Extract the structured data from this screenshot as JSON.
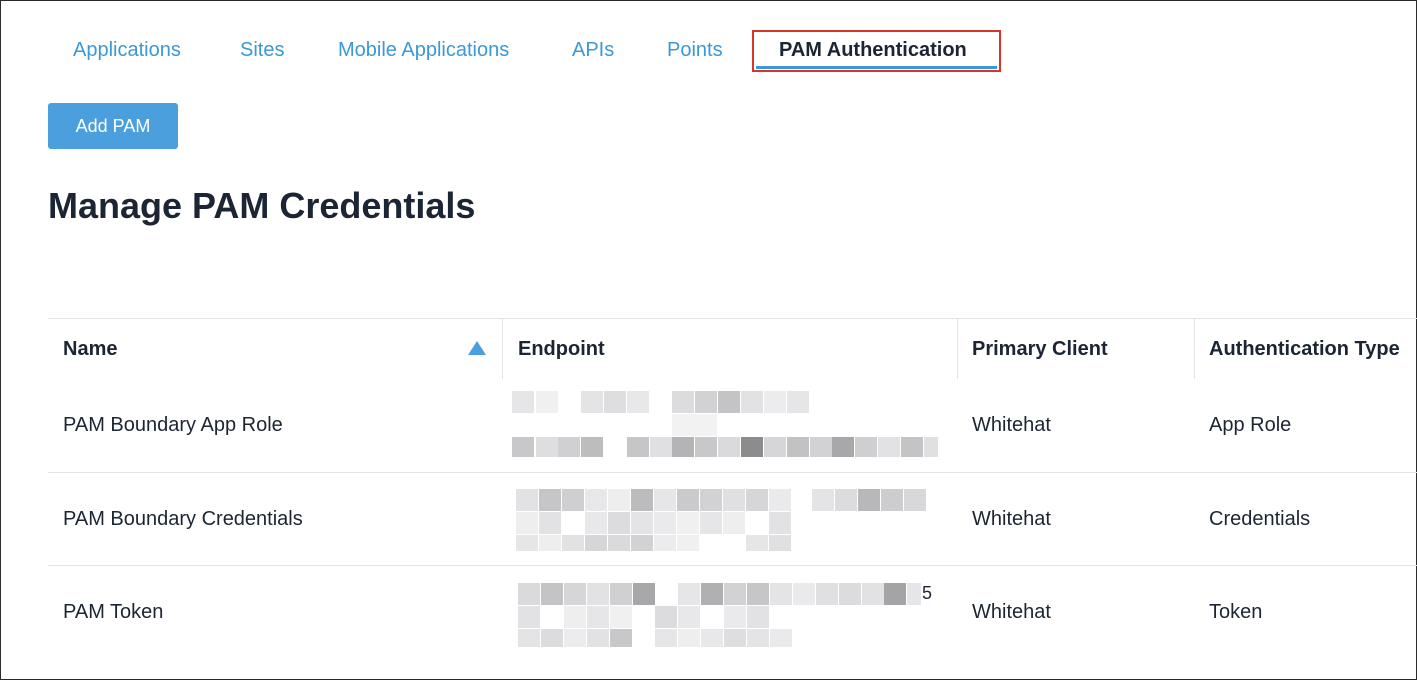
{
  "tabs": [
    {
      "label": "Applications"
    },
    {
      "label": "Sites"
    },
    {
      "label": "Mobile Applications"
    },
    {
      "label": "APIs"
    },
    {
      "label": "Points"
    },
    {
      "label": "PAM Authentication"
    }
  ],
  "active_tab": "PAM Authentication",
  "add_button": {
    "label": "Add PAM"
  },
  "page_title": "Manage PAM Credentials",
  "table": {
    "columns": [
      "Name",
      "Endpoint",
      "Primary Client",
      "Authentication Type"
    ],
    "sort": {
      "column": "Name",
      "direction": "ascending"
    },
    "rows": [
      {
        "name": "PAM Boundary App Role",
        "endpoint": "",
        "primary_client": "Whitehat",
        "auth_type": "App Role"
      },
      {
        "name": "PAM Boundary Credentials",
        "endpoint": "",
        "primary_client": "Whitehat",
        "auth_type": "Credentials"
      },
      {
        "name": "PAM Token",
        "endpoint": "5",
        "primary_client": "Whitehat",
        "auth_type": "Token"
      }
    ]
  },
  "colors": {
    "accent": "#3c98d6",
    "button": "#4a9fdc",
    "highlight_box": "#d9342b",
    "text": "#1c2533"
  },
  "icons": {
    "sort": "sort-ascending-icon"
  }
}
